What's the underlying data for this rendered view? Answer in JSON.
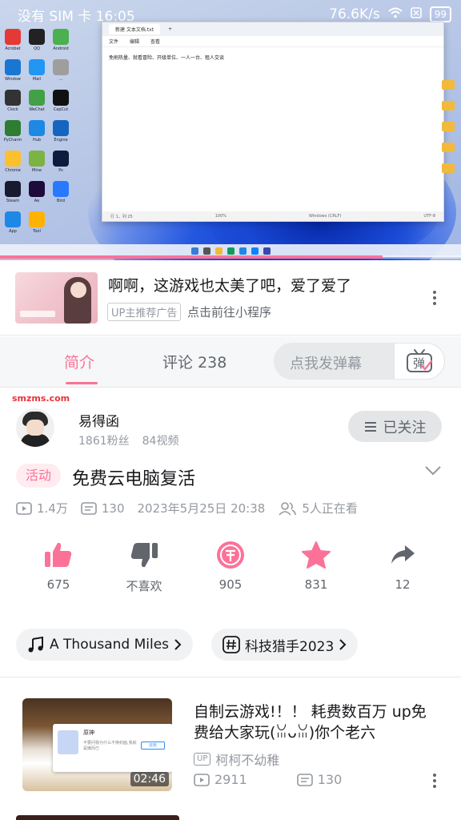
{
  "status_bar": {
    "carrier_time": "没有 SIM 卡 16:05",
    "net_speed": "76.6K/s",
    "battery": "99"
  },
  "player": {
    "notepad": {
      "tab_title": "新建 文本文档.txt",
      "menu": [
        "文件",
        "编辑",
        "查看"
      ],
      "content": "免刷热量、就看冒险、开级单位、一人一台、租人交谈",
      "status_left": "行 1，列 25",
      "status_zoom": "100%",
      "status_eol": "Windows (CRLF)",
      "status_enc": "UTF-8"
    },
    "progress_fraction": 0.83
  },
  "ad": {
    "title": "啊啊，这游戏也太美了吧，爱了爱了",
    "badge": "UP主推荐广告",
    "link": "点击前往小程序"
  },
  "tabs": {
    "intro": "简介",
    "comments": "评论 238",
    "danmaku_placeholder": "点我发弹幕",
    "danmaku_button": "弹"
  },
  "uploader": {
    "watermark": "smzms.com",
    "name": "易得函",
    "fans": "1861粉丝",
    "videos": "84视频",
    "follow": "已关注"
  },
  "video": {
    "tag": "活动",
    "title": "免费云电脑复活",
    "views": "1.4万",
    "danmaku": "130",
    "date": "2023年5月25日 20:38",
    "watching": "5人正在看"
  },
  "actions": {
    "like": "675",
    "dislike": "不喜欢",
    "coin": "905",
    "favorite": "831",
    "share": "12"
  },
  "chips": {
    "music": "A Thousand Miles",
    "topic": "科技猎手2023"
  },
  "related": {
    "thumb_title": "原神",
    "thumb_sub": "不要问我为什么不换封面,我就是懒而已",
    "thumb_btn": "云玩",
    "duration": "02:46",
    "title": "自制云游戏!！！ 耗费数百万 up免费给大家玩(ꈍᴗꈍ)你个老六",
    "up_badge": "UP",
    "author": "柯柯不幼稚",
    "views": "2911",
    "danmaku": "130"
  },
  "colors": {
    "accent": "#fb7299",
    "text_primary": "#18191c",
    "text_secondary": "#61666d",
    "text_muted": "#9499a0"
  }
}
